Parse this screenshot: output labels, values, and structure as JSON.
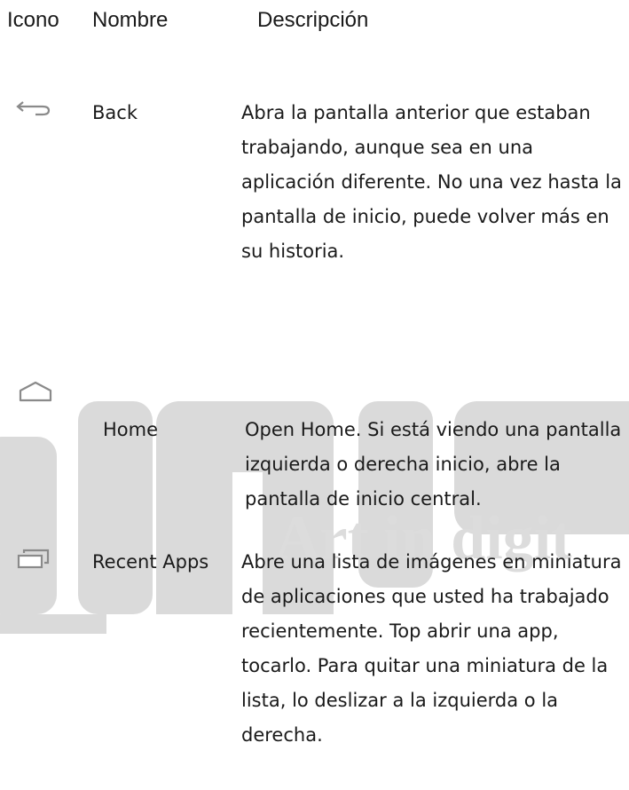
{
  "header": {
    "col_icon": "Icono",
    "col_name": "Nombre",
    "col_desc": "Descripción"
  },
  "rows": [
    {
      "icon": "back-arrow-icon",
      "name": "Back",
      "description": "Abra la pantalla anterior que estaban trabajando, aunque sea en una aplicación diferente. No una vez hasta la pantalla de inicio, puede volver más en su historia."
    },
    {
      "icon": "home-icon",
      "name": "Home",
      "description": "Open Home. Si está viendo una pantalla izquierda o derecha inicio, abre la pantalla de inicio central."
    },
    {
      "icon": "recent-apps-icon",
      "name": "Recent Apps",
      "description": "Abre una lista de imágenes en miniatura de aplicaciones que usted ha trabajado recientemente. Top abrir una app, tocarlo. Para quitar una miniatura de la lista, lo deslizar a la izquierda o la derecha."
    }
  ],
  "watermark": {
    "text": "Art in digit",
    "color": "#dadada"
  }
}
